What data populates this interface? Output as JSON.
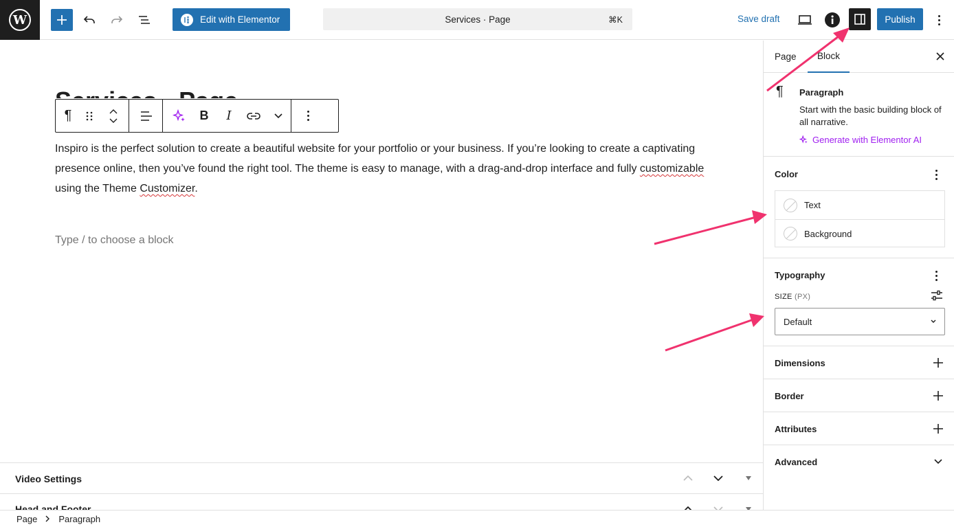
{
  "header": {
    "logo_letter": "W",
    "elementor_label": "Edit with Elementor",
    "command_bar_title": "Services · Page",
    "command_bar_shortcut": "⌘K",
    "save_draft_label": "Save draft",
    "publish_label": "Publish"
  },
  "editor": {
    "paragraph": {
      "part1": "Inspiro is the perfect solution to create a beautiful website for your portfolio or your business. If you’re looking to create a captivating presence online, then you’ve found the right tool. The theme is easy to manage, with a drag-and-drop interface and fully ",
      "word_customizable": "customizable",
      "part2": " using the Theme ",
      "word_customizer": "Customizer",
      "part3": "."
    },
    "placeholder": "Type / to choose a block"
  },
  "meta_boxes": [
    {
      "title": "Video Settings"
    },
    {
      "title": "Head and Footer"
    }
  ],
  "breadcrumb": [
    "Page",
    "Paragraph"
  ],
  "sidebar": {
    "tabs": [
      "Page",
      "Block"
    ],
    "active_tab": "Block",
    "block": {
      "name": "Paragraph",
      "description": "Start with the basic building block of all narrative.",
      "ai_link": "Generate with Elementor AI"
    },
    "color": {
      "heading": "Color",
      "items": [
        "Text",
        "Background"
      ]
    },
    "typography": {
      "heading": "Typography",
      "size_label": "SIZE",
      "size_unit": "(PX)",
      "size_value": "Default"
    },
    "sections": [
      "Dimensions",
      "Border",
      "Attributes",
      "Advanced"
    ]
  },
  "colors": {
    "accent": "#2271b1",
    "dark": "#1e1e1e",
    "ai_purple": "#a020f0",
    "annotation_arrow": "#f0326e"
  }
}
